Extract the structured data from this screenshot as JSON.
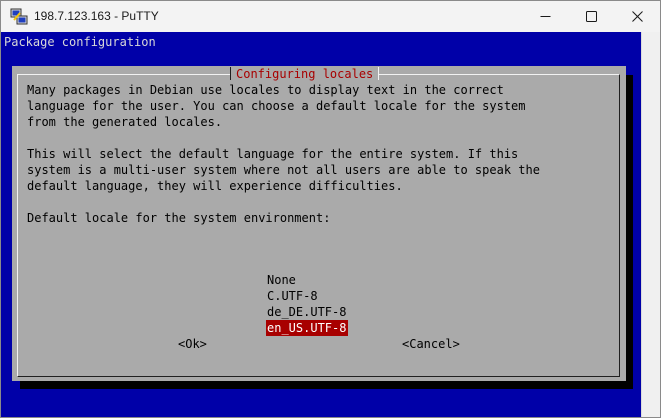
{
  "window": {
    "title": "198.7.123.163 - PuTTY",
    "icon": "putty-icon"
  },
  "controls": {
    "minimize_icon": "minimize-icon",
    "maximize_icon": "maximize-icon",
    "close_icon": "close-icon"
  },
  "terminal": {
    "header": "Package configuration",
    "colors": {
      "background": "#0000a8",
      "dialog": "#aaaaaa",
      "highlight": "#a80000",
      "title_text": "#a80000"
    }
  },
  "dialog": {
    "title": "Configuring locales",
    "paragraph1": [
      "Many packages in Debian use locales to display text in the correct",
      "language for the user. You can choose a default locale for the system",
      "from the generated locales."
    ],
    "paragraph2": [
      "This will select the default language for the entire system. If this",
      "system is a multi-user system where not all users are able to speak the",
      "default language, they will experience difficulties."
    ],
    "prompt": "Default locale for the system environment:",
    "options": [
      "None",
      "C.UTF-8",
      "de_DE.UTF-8",
      "en_US.UTF-8"
    ],
    "selected": "en_US.UTF-8",
    "ok_label": "<Ok>",
    "cancel_label": "<Cancel>"
  }
}
